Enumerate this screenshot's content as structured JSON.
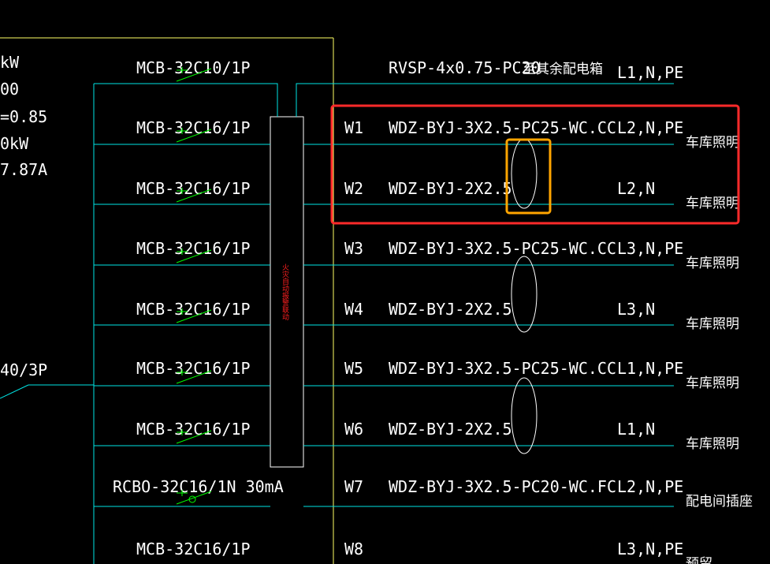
{
  "left_params": [
    "kW",
    "00",
    "=0.85",
    "0kW",
    "7.87A"
  ],
  "main_breaker": "40/3P",
  "busbar_label": "火灾自动报警联动",
  "top_feed": {
    "cable": "RVSP-4x0.75-PC20",
    "dest": "至其余配电箱",
    "phase": "L1,N,PE"
  },
  "circuits": [
    {
      "breaker": "MCB-32C10/1P",
      "id": "",
      "cable": "",
      "phase": "",
      "use": ""
    },
    {
      "breaker": "MCB-32C16/1P",
      "id": "W1",
      "cable": "WDZ-BYJ-3X2.5-PC25-WC.CC",
      "phase": "L2,N,PE",
      "use": "车库照明"
    },
    {
      "breaker": "MCB-32C16/1P",
      "id": "W2",
      "cable": "WDZ-BYJ-2X2.5",
      "phase": "L2,N",
      "use": "车库照明"
    },
    {
      "breaker": "MCB-32C16/1P",
      "id": "W3",
      "cable": "WDZ-BYJ-3X2.5-PC25-WC.CC",
      "phase": "L3,N,PE",
      "use": "车库照明"
    },
    {
      "breaker": "MCB-32C16/1P",
      "id": "W4",
      "cable": "WDZ-BYJ-2X2.5",
      "phase": "L3,N",
      "use": "车库照明"
    },
    {
      "breaker": "MCB-32C16/1P",
      "id": "W5",
      "cable": "WDZ-BYJ-3X2.5-PC25-WC.CC",
      "phase": "L1,N,PE",
      "use": "车库照明"
    },
    {
      "breaker": "MCB-32C16/1P",
      "id": "W6",
      "cable": "WDZ-BYJ-2X2.5",
      "phase": "L1,N",
      "use": "车库照明"
    },
    {
      "breaker": "RCBO-32C16/1N 30mA",
      "id": "W7",
      "cable": "WDZ-BYJ-3X2.5-PC20-WC.FC",
      "phase": "L2,N,PE",
      "use": "配电间插座"
    },
    {
      "breaker": "MCB-32C16/1P",
      "id": "W8",
      "cable": "",
      "phase": "L3,N,PE",
      "use": "预留"
    }
  ],
  "colors": {
    "background": "#000000",
    "wire": "#00e5e5",
    "breaker": "#00ff00",
    "frame": "#ffff66",
    "highlight_red": "#ff2a2a",
    "highlight_orange": "#ffa500",
    "text": "#ffffff"
  }
}
